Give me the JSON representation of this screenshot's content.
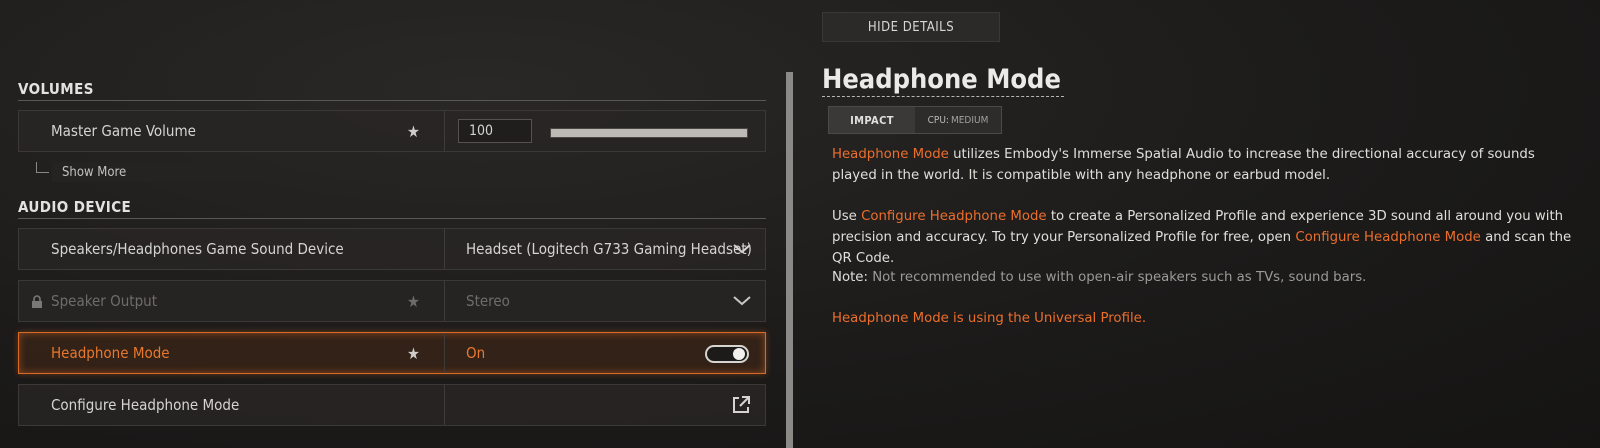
{
  "header": {
    "hide_details_label": "HIDE DETAILS"
  },
  "volumes": {
    "section_title": "VOLUMES",
    "master_volume": {
      "label": "Master Game Volume",
      "value": "100",
      "level_fraction": 1.0
    },
    "show_more_label": "Show More"
  },
  "audio_device": {
    "section_title": "AUDIO DEVICE",
    "rows": [
      {
        "label": "Speakers/Headphones Game Sound Device",
        "value": "Headset (Logitech G733 Gaming Headset)"
      },
      {
        "label": "Speaker Output",
        "value": "Stereo"
      },
      {
        "label": "Headphone Mode",
        "value": "On"
      },
      {
        "label": "Configure Headphone Mode",
        "value": ""
      }
    ]
  },
  "details": {
    "title": "Headphone Mode",
    "impact_label": "IMPACT",
    "cpu_label": "CPU:",
    "cpu_value": "MEDIUM",
    "p1": {
      "hl": "Headphone Mode",
      "text": " utilizes Embody's Immerse Spatial Audio to increase the directional accuracy of sounds played in the world. It is compatible with any headphone or earbud model."
    },
    "p2": {
      "t1": "Use ",
      "hl1": "Configure Headphone Mode",
      "t2": " to create a Personalized Profile and experience 3D sound all around you with precision and accuracy.  To try your Personalized Profile for free, open ",
      "hl2": "Configure Headphone Mode",
      "t3": " and scan the QR Code."
    },
    "note": {
      "label": "Note:",
      "text": " Not recommended to use with open-air speakers such as TVs, sound bars."
    },
    "status": "Headphone Mode is using the Universal Profile."
  },
  "colors": {
    "accent": "#ec6e2c",
    "background": "#1c1b1a"
  },
  "icons": [
    "star-icon",
    "chevron-down-icon",
    "lock-icon",
    "external-link-icon",
    "toggle-switch"
  ]
}
